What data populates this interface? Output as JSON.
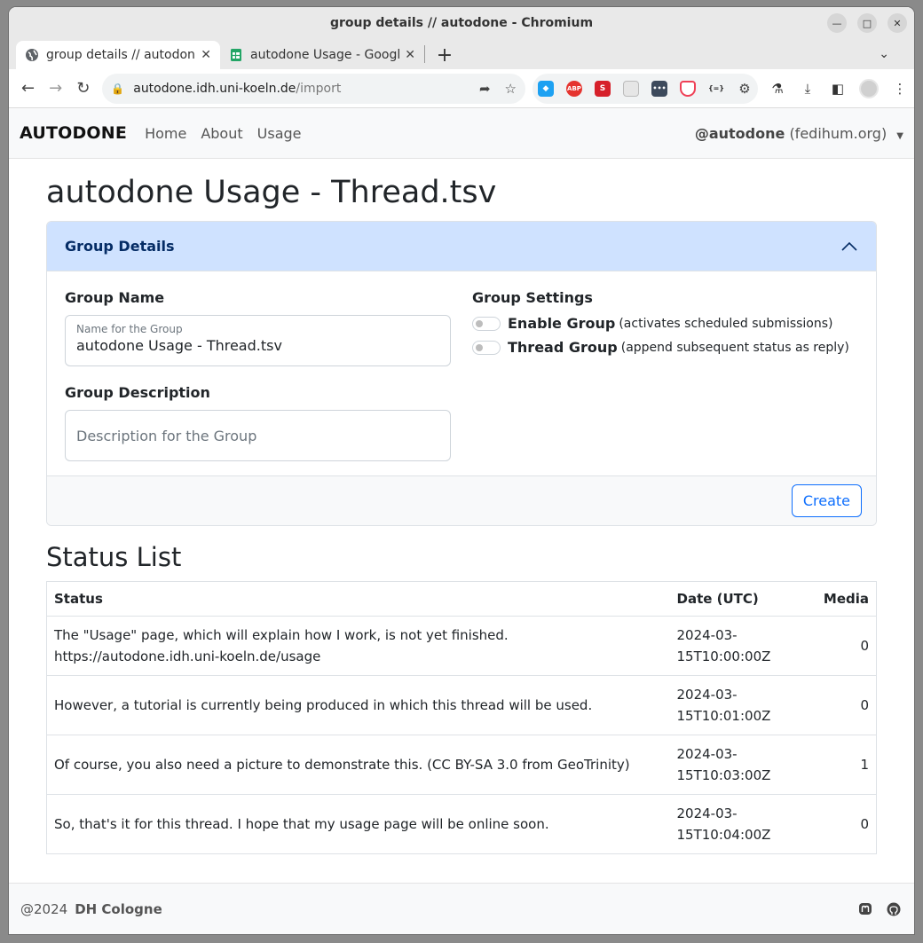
{
  "window": {
    "title": "group details // autodone - Chromium"
  },
  "tabs": [
    {
      "label": "group details // autodone",
      "active": true
    },
    {
      "label": "autodone Usage - Google",
      "active": false
    }
  ],
  "toolbar": {
    "url_host": "autodone.idh.uni-koeln.de",
    "url_path": "/import"
  },
  "extensions": [
    {
      "name": "twitter-extension-icon",
      "color": "#1da1f2",
      "text": ""
    },
    {
      "name": "adblock-plus-icon",
      "color": "#e5342f",
      "text": "ABP"
    },
    {
      "name": "s-extension-icon",
      "color": "#d6202a",
      "text": "S"
    },
    {
      "name": "document-extension-icon",
      "color": "#e0e0e0",
      "text": ""
    },
    {
      "name": "dots-extension-icon",
      "color": "#3d4a5c",
      "text": "•••"
    },
    {
      "name": "pocket-icon",
      "color": "#ef4056",
      "text": ""
    },
    {
      "name": "json-extension-icon",
      "color": "#f1f3f4",
      "text": "{=}"
    }
  ],
  "navbar": {
    "brand": "AUTODONE",
    "links": [
      "Home",
      "About",
      "Usage"
    ],
    "account_handle": "@autodone",
    "account_instance": "(fedihum.org)"
  },
  "page": {
    "title": "autodone Usage - Thread.tsv"
  },
  "group_details": {
    "header": "Group Details",
    "name_heading": "Group Name",
    "name_label": "Name for the Group",
    "name_value": "autodone Usage - Thread.tsv",
    "description_heading": "Group Description",
    "description_placeholder": "Description for the Group",
    "settings_heading": "Group Settings",
    "enable_title": "Enable Group",
    "enable_desc": "(activates scheduled submissions)",
    "thread_title": "Thread Group",
    "thread_desc": "(append subsequent status as reply)",
    "create_label": "Create"
  },
  "status_list": {
    "heading": "Status List",
    "columns": [
      "Status",
      "Date (UTC)",
      "Media"
    ],
    "rows": [
      {
        "status": "The \"Usage\" page, which will explain how I work, is not yet finished. https://autodone.idh.uni-koeln.de/usage",
        "date": "2024-03-15T10:00:00Z",
        "media": "0"
      },
      {
        "status": "However, a tutorial is currently being produced in which this thread will be used.",
        "date": "2024-03-15T10:01:00Z",
        "media": "0"
      },
      {
        "status": "Of course, you also need a picture to demonstrate this. (CC BY-SA 3.0 from GeoTrinity)",
        "date": "2024-03-15T10:03:00Z",
        "media": "1"
      },
      {
        "status": "So, that's it for this thread. I hope that my usage page will be online soon.",
        "date": "2024-03-15T10:04:00Z",
        "media": "0"
      }
    ]
  },
  "footer": {
    "copyright": "@2024",
    "org": "DH Cologne"
  }
}
